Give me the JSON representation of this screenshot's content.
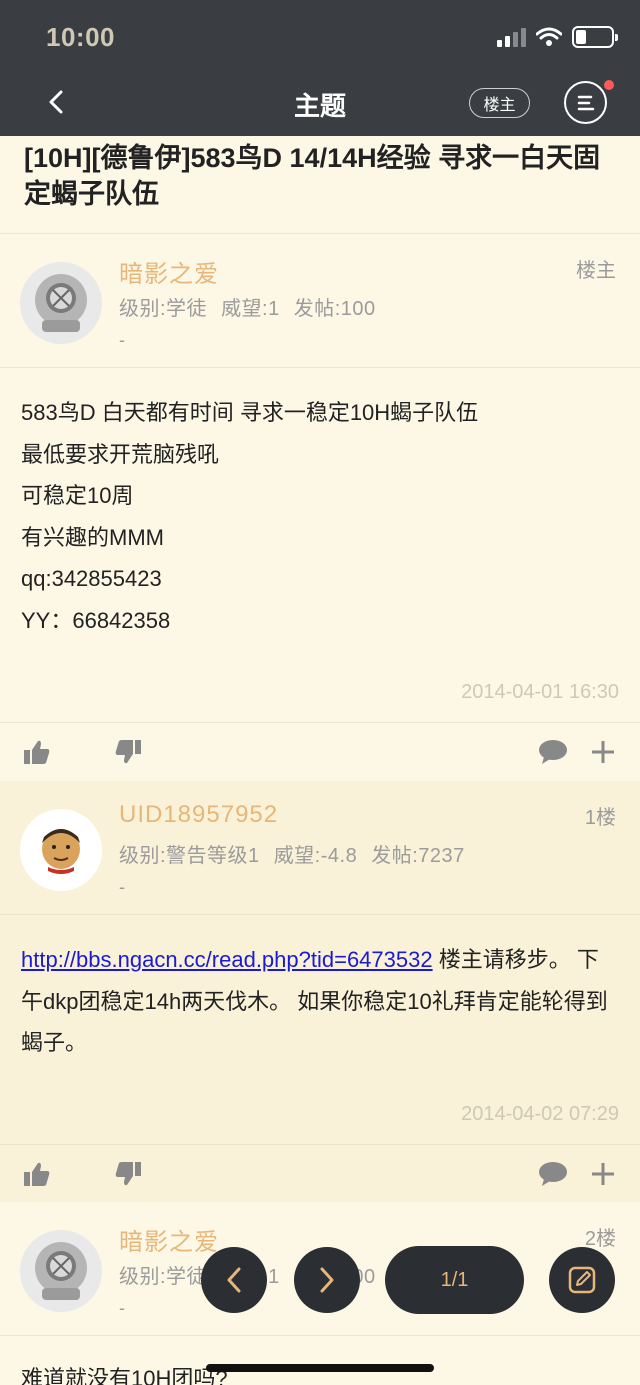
{
  "status": {
    "time": "10:00"
  },
  "nav": {
    "title": "主题",
    "lz_label": "楼主"
  },
  "topic": {
    "title": "[10H][德鲁伊]583鸟D 14/14H经验 寻求一白天固定蝎子队伍"
  },
  "posts": [
    {
      "author": "暗影之爱",
      "level": "级别:学徒",
      "prestige": "威望:1",
      "posts": "发帖:100",
      "dash": "-",
      "floor": "楼主",
      "lines": [
        "583鸟D 白天都有时间 寻求一稳定10H蝎子队伍",
        "最低要求开荒脑残吼",
        "可稳定10周",
        "有兴趣的MMM",
        "qq:342855423",
        "YY：66842358"
      ],
      "time": "2014-04-01 16:30"
    },
    {
      "author": "UID18957952",
      "level": "级别:警告等级1",
      "prestige": "威望:-4.8",
      "posts": "发帖:7237",
      "dash": "-",
      "floor": "1楼",
      "link": "http://bbs.ngacn.cc/read.php?tid=6473532",
      "text": " 楼主请移步。 下午dkp团稳定14h两天伐木。 如果你稳定10礼拜肯定能轮得到蝎子。",
      "time": "2014-04-02 07:29"
    },
    {
      "author": "暗影之爱",
      "level": "级别:学徒",
      "prestige": "威望:1",
      "posts": "发帖:100",
      "dash": "-",
      "floor": "2楼",
      "text": "难道就没有10H团吗?"
    }
  ],
  "pager": {
    "label": "1/1"
  },
  "icons": [
    "back-icon",
    "menu-icon",
    "thumb-up-icon",
    "thumb-down-icon",
    "comment-icon",
    "plus-icon",
    "prev-icon",
    "next-icon",
    "edit-icon"
  ],
  "colors": {
    "header": "#3a3e42",
    "bg": "#fdf8e6",
    "author": "#e7b679",
    "link": "#1a1ad6",
    "fab": "#2b2e32"
  }
}
